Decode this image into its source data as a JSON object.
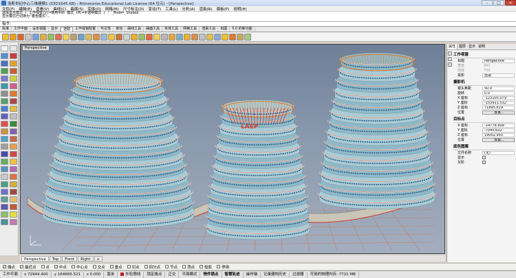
{
  "window": {
    "title": "洛斯世纪中心三维建模1 (33D1645 KB) - Rhinoceros Educational Lab License (64 位元) - [Perspective]"
  },
  "menu": [
    "文件(F)",
    "编辑(E)",
    "查看(V)",
    "曲线(C)",
    "曲面(S)",
    "实体(O)",
    "网格(M)",
    "尺寸标注(D)",
    "变动(T)",
    "工具(L)",
    "分析(A)",
    "渲染(R)",
    "面板(P)",
    "说明(H)"
  ],
  "command": {
    "history": [
      "选择显示模式 ( 工作视窗(V)=使用中的  模式 (M)=半透明模式 ) : _Mode=_Shaded",
      "显示模式已切换为\"着色模式\"。"
    ],
    "prompt": "指令:"
  },
  "toolbar_tabs": [
    "标准",
    "工作平面",
    "设定视图",
    "显示",
    "选取",
    "工作视窗配置",
    "可见性",
    "变动",
    "曲线工具",
    "曲面工具",
    "实体工具",
    "网格工具",
    "渲染工具",
    "出图",
    "5.0 的新功能"
  ],
  "toolbar_tab_active": 4,
  "viewport": {
    "label": "Perspective",
    "tabs": [
      "Perspective",
      "Top",
      "Front",
      "Right"
    ],
    "add_tab": "+"
  },
  "osnap": [
    {
      "label": "端点",
      "checked": true
    },
    {
      "label": "最近点",
      "checked": true
    },
    {
      "label": "点",
      "checked": false
    },
    {
      "label": "中点",
      "checked": true
    },
    {
      "label": "中心点",
      "checked": false
    },
    {
      "label": "交点",
      "checked": false
    },
    {
      "label": "垂点",
      "checked": false
    },
    {
      "label": "切点",
      "checked": false
    },
    {
      "label": "四分点",
      "checked": false
    },
    {
      "label": "节点",
      "checked": false
    },
    {
      "label": "顶点",
      "checked": false
    },
    {
      "label": "投影",
      "checked": false
    },
    {
      "label": "停用",
      "checked": false
    }
  ],
  "status": {
    "cplane": "工作平面",
    "x": "x 72944.400",
    "y": "y 164666.521",
    "z": "z 0.000",
    "units": "毫米",
    "layer": "外轮廓线",
    "toggles": [
      "锁定格点",
      "正交",
      "平面模式",
      "物件锁点",
      "智慧轨迹",
      "操作轴",
      "记录建构历史",
      "过滤器",
      "可用的物理内存: 7721 MB"
    ]
  },
  "properties": {
    "tabs": [
      "属性",
      "图层",
      "显示",
      "说明"
    ],
    "viewport_section": "工作视窗",
    "title_label": "标题",
    "title_value": "Perspective",
    "width_label": "宽度",
    "width_value": "992",
    "height_label": "高度",
    "height_value": "750",
    "projection_label": "投影",
    "projection_value": "透视",
    "camera_section": "摄影机",
    "lens_label": "镜头焦距",
    "lens_value": "50.0",
    "rotation_label": "旋转",
    "rotation_value": "0.0",
    "cx_label": "X 座标",
    "cx_value": "-123105.079",
    "cy_label": "Y 座标",
    "cy_value": "-153911.532",
    "cz_label": "Z 座标",
    "cz_value": "71895.619",
    "cpos_label": "位置",
    "cpos_btn": "放置...",
    "target_section": "目标点",
    "tx_label": "X 座标",
    "tx_value": "-14776.909",
    "ty_label": "Y 座标",
    "ty_value": "-7045.632",
    "tz_label": "Z 座标",
    "tz_value": "19002.950",
    "tpos_label": "位置",
    "tpos_btn": "放置...",
    "wallpaper_section": "底色图案",
    "file_label": "文件名称",
    "file_value": "(无)",
    "show_label": "显示",
    "gray_label": "灰阶"
  },
  "colors": {
    "accent_orange": "#e8771f",
    "building_red": "#d43a2a",
    "glass_blue": "#4aa3c8",
    "grid_orange": "#e05a1a"
  }
}
